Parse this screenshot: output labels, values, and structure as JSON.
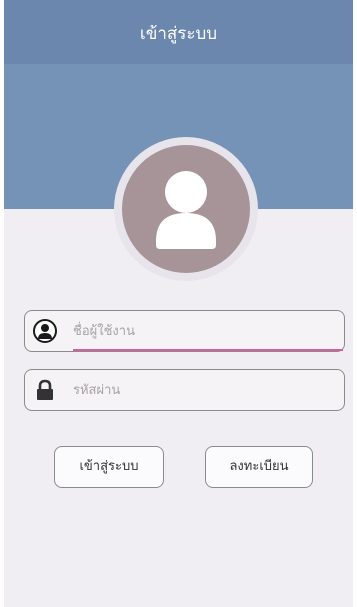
{
  "titlebar": {
    "title": "เข้าสู่ระบบ"
  },
  "profile": {
    "avatar_icon": "user-avatar-icon"
  },
  "form": {
    "username": {
      "placeholder": "ชื่อผู้ใช้งาน",
      "value": "",
      "icon": "user-circle-icon"
    },
    "password": {
      "placeholder": "รหัสผ่าน",
      "value": "",
      "icon": "lock-icon"
    }
  },
  "actions": {
    "login_label": "เข้าสู่ระบบ",
    "register_label": "ลงทะเบียน"
  },
  "colors": {
    "titlebar": "#6b87ad",
    "header_band": "#7592b7",
    "avatar": "#a69499",
    "focus_underline": "#d45f9a",
    "background": "#f0eef2"
  }
}
